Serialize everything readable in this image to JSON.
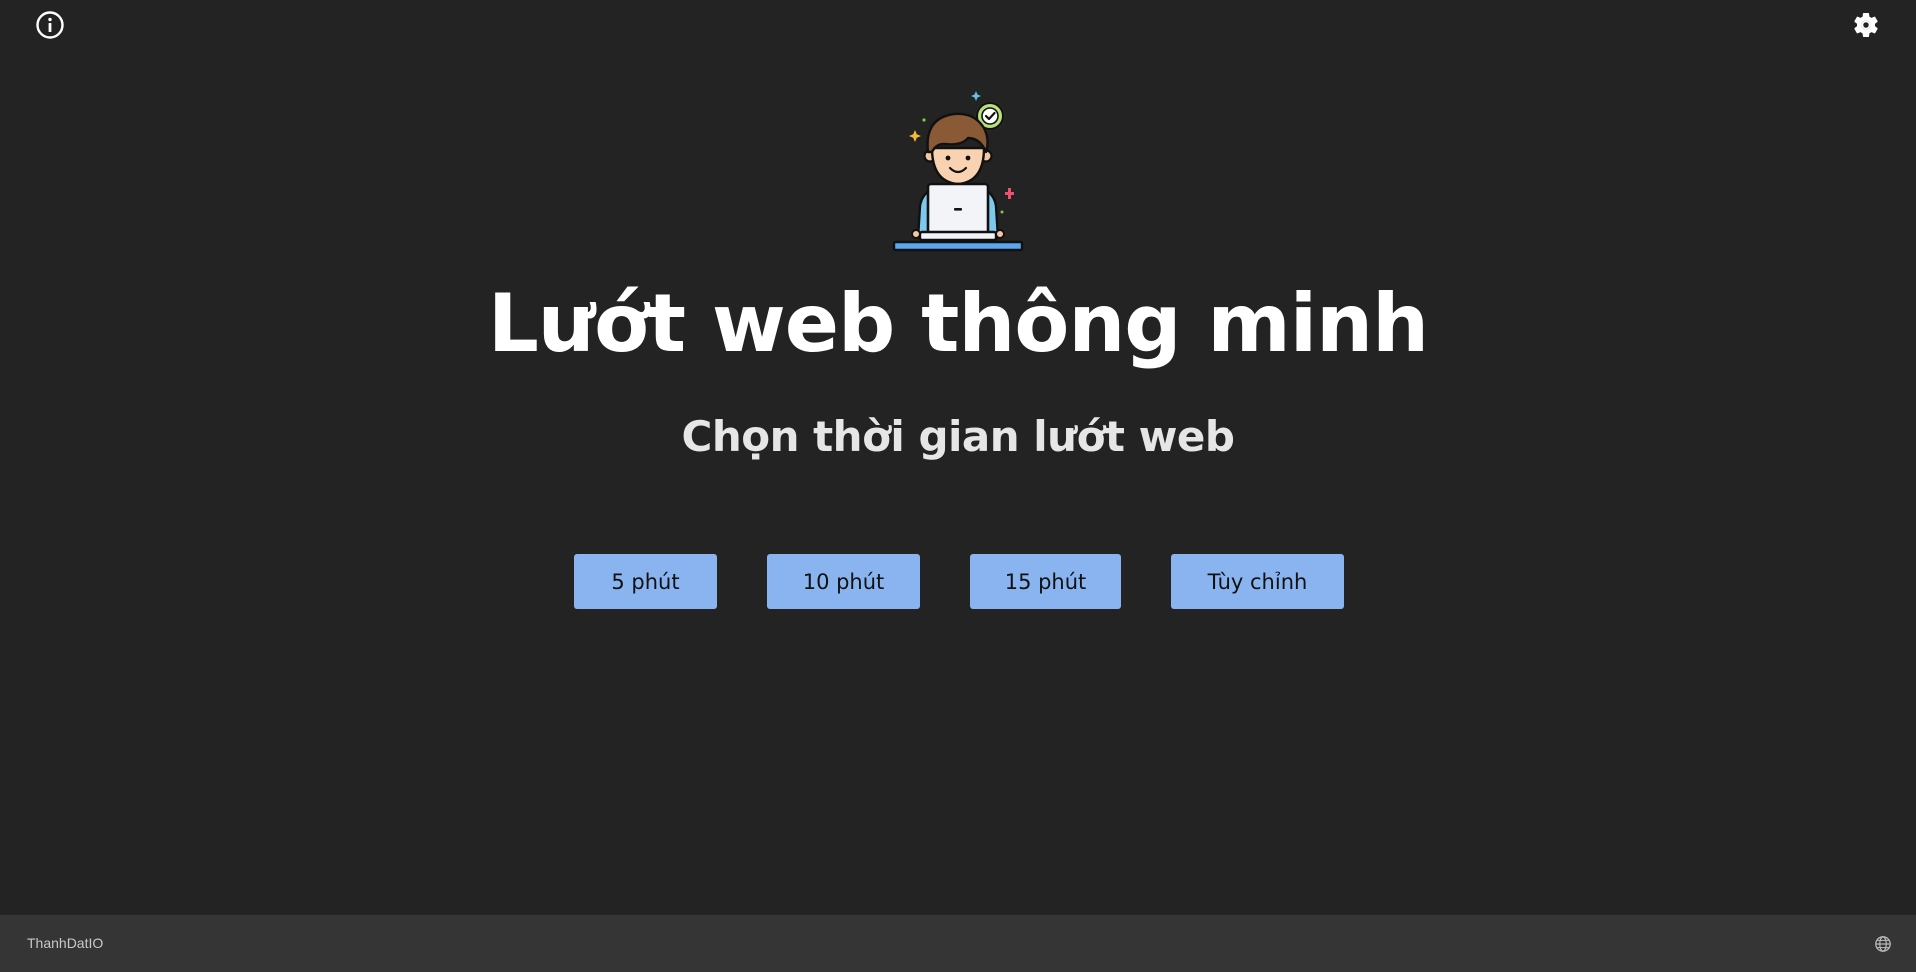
{
  "header": {
    "info_icon": "info-circle-icon",
    "settings_icon": "gear-icon"
  },
  "hero": {
    "illustration": "person-with-laptop-checkmark-illustration",
    "title": "Lướt web thông minh",
    "subtitle": "Chọn thời gian lướt web"
  },
  "time_options": [
    {
      "label": "5 phút"
    },
    {
      "label": "10 phút"
    },
    {
      "label": "15 phút"
    },
    {
      "label": "Tùy chỉnh"
    }
  ],
  "footer": {
    "brand": "ThanhDatIO",
    "language_icon": "globe-icon"
  },
  "colors": {
    "background": "#232323",
    "footer_background": "#353535",
    "button_accent": "#8ab4f0",
    "title_text": "#ffffff"
  }
}
